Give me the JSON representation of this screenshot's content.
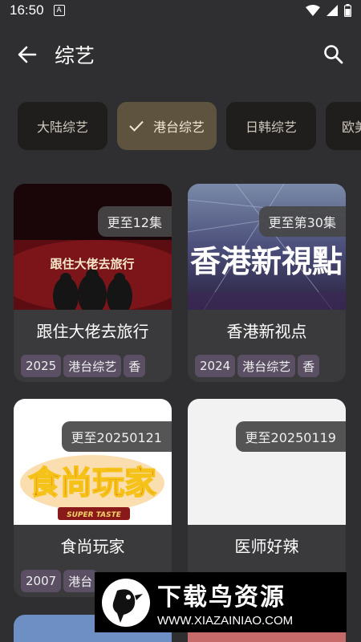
{
  "status_bar": {
    "time": "16:50",
    "notification_icon": "A"
  },
  "header": {
    "title": "综艺"
  },
  "chips": [
    {
      "label": "大陆综艺",
      "selected": false
    },
    {
      "label": "港台综艺",
      "selected": true
    },
    {
      "label": "日韩综艺",
      "selected": false
    },
    {
      "label": "欧美",
      "selected": false
    }
  ],
  "cards": [
    {
      "title": "跟住大佬去旅行",
      "badge": "更至12集",
      "year": "2025",
      "category": "港台综艺",
      "region": "香",
      "poster_text": "跟住大佬去旅行"
    },
    {
      "title": "香港新视点",
      "badge": "更至第30集",
      "year": "2024",
      "category": "港台综艺",
      "region": "香",
      "poster_text": "香港新視點"
    },
    {
      "title": "食尚玩家",
      "badge": "更至20250121",
      "year": "2007",
      "category": "港台",
      "region": "",
      "poster_text": "食尚玩家",
      "poster_sub": "SUPER TASTE"
    },
    {
      "title": "医师好辣",
      "badge": "更至20250119",
      "year": "",
      "category": "",
      "region": ""
    }
  ],
  "watermark": {
    "title": "下载鸟资源",
    "url": "WWW.XIAZAINIAO.COM"
  },
  "colors": {
    "background": "#2f2f31",
    "chip": "#1f1e1c",
    "chip_active": "#5d533f",
    "tag": "#5a4f63"
  }
}
